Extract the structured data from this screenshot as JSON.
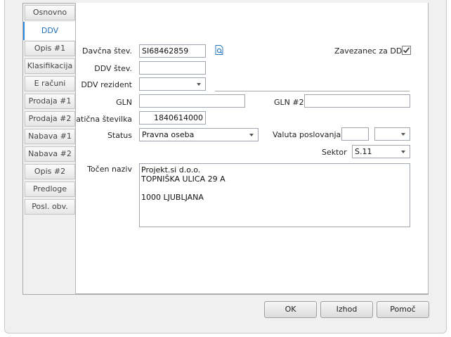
{
  "tabs": [
    {
      "label": "Osnovno"
    },
    {
      "label": "DDV"
    },
    {
      "label": "Opis #1"
    },
    {
      "label": "Klasifikacija"
    },
    {
      "label": "E računi"
    },
    {
      "label": "Prodaja #1"
    },
    {
      "label": "Prodaja #2"
    },
    {
      "label": "Nabava #1"
    },
    {
      "label": "Nabava #2"
    },
    {
      "label": "Opis #2"
    },
    {
      "label": "Predloge"
    },
    {
      "label": "Posl. obv."
    }
  ],
  "active_tab": "DDV",
  "form": {
    "davcna_label": "Davčna štev.",
    "davcna_value": "SI68462859",
    "ddv_stev_label": "DDV štev.",
    "ddv_stev_value": "",
    "ddv_rezident_label": "DDV rezident",
    "ddv_rezident_value": "",
    "zavezanec_label": "Zavezanec za DDV",
    "zavezanec_checked": true,
    "gln_label": "GLN",
    "gln_value": "",
    "gln2_label": "GLN #2",
    "gln2_value": "",
    "maticna_label": "Matična številka",
    "maticna_value": "1840614000",
    "status_label": "Status",
    "status_value": "Pravna oseba",
    "valuta_label": "Valuta poslovanja",
    "valuta_value": "",
    "valuta_combo_value": "",
    "sektor_label": "Sektor",
    "sektor_value": "S.11",
    "tocen_naziv_label": "Točen naziv",
    "tocen_naziv_lines": [
      "Projekt.si d.o.o.",
      "TOPNIŠKA ULICA 29 A",
      "",
      "1000 LJUBLJANA"
    ]
  },
  "buttons": {
    "ok": "OK",
    "izhod": "Izhod",
    "pomoc": "Pomoč"
  },
  "icons": {
    "lookup": "document-search-icon",
    "check": "checkmark-icon"
  }
}
